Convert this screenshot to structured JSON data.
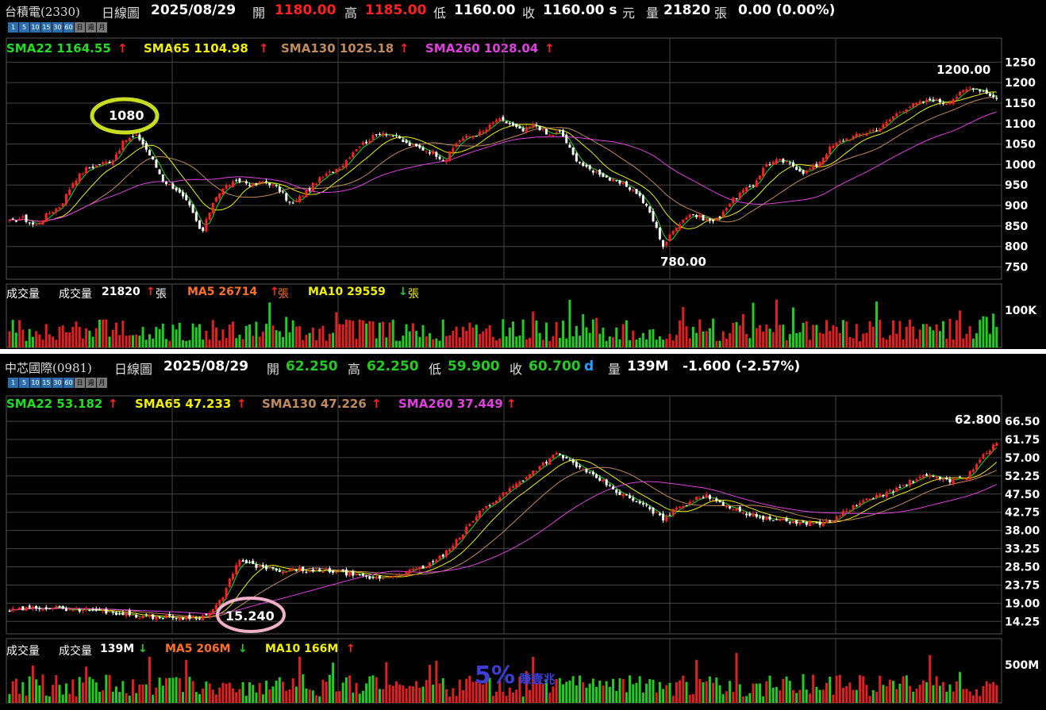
{
  "colors": {
    "up": "#ff2020",
    "down": "#ffffff",
    "vol_up": "#e02020",
    "vol_down": "#22cc22",
    "sma22": "#22dd22",
    "sma65": "#f0f000",
    "sma130": "#c08a5a",
    "sma260": "#e040e0",
    "ma5": "#ff7020",
    "ma10": "#f0f000",
    "grid": "#444444",
    "axis": "#ffffff"
  },
  "icons": {
    "arrow_up": "up-arrow-icon",
    "arrow_down": "down-arrow-icon"
  },
  "timeframes": [
    "1",
    "5",
    "10",
    "15",
    "30",
    "60",
    "日",
    "週",
    "月"
  ],
  "panels": [
    {
      "quote": {
        "name": "台積電(2330)",
        "period": "日線圖",
        "date": "2025/08/29",
        "open_label": "開",
        "open": "1180.00",
        "high_label": "高",
        "high": "1185.00",
        "low_label": "低",
        "low": "1160.00",
        "close_label": "收",
        "close": "1160.00 s",
        "unit_label": "元",
        "vol_label": "量",
        "vol": "21820",
        "vol_unit": "張",
        "change": "0.00 (0.00%)"
      },
      "sma": {
        "sma22": "SMA22 1164.55",
        "sma65": "SMA65 1104.98",
        "sma130": "SMA130 1025.18",
        "sma260": "SMA260 1028.04"
      },
      "sma_dirs": [
        "up",
        "up",
        "up",
        "up"
      ],
      "volume": {
        "title": "成交量",
        "vol_label": "成交量",
        "vol": "21820",
        "vol_unit": "張",
        "ma5": "MA5 26714",
        "ma5_unit": "張",
        "ma10": "MA10 29559",
        "ma10_unit": "張",
        "dirs": [
          "up",
          "up",
          "down"
        ]
      },
      "price_axis": [
        "1250",
        "1200",
        "1150",
        "1100",
        "1050",
        "1000",
        "950",
        "900",
        "850",
        "800",
        "750"
      ],
      "vol_axis": [
        "100K"
      ],
      "annotations": {
        "circle": "1080",
        "high": "1200.00",
        "low": "780.00"
      }
    },
    {
      "quote": {
        "name": "中芯國際(0981)",
        "period": "日線圖",
        "date": "2025/08/29",
        "open_label": "開",
        "open": "62.250",
        "high_label": "高",
        "high": "62.250",
        "low_label": "低",
        "low": "59.900",
        "close_label": "收",
        "close": "60.700",
        "close_flag": "d",
        "vol_label": "量",
        "vol": "139M",
        "change": "-1.600 (-2.57%)"
      },
      "sma": {
        "sma22": "SMA22 53.182",
        "sma65": "SMA65 47.233",
        "sma130": "SMA130 47.226",
        "sma260": "SMA260 37.449"
      },
      "sma_dirs": [
        "up",
        "up",
        "up",
        "up"
      ],
      "volume": {
        "title": "成交量",
        "vol_label": "成交量",
        "vol": "139M",
        "ma5": "MA5 206M",
        "ma10": "MA10 166M",
        "dirs": [
          "down",
          "down",
          "up"
        ]
      },
      "price_axis": [
        "66.50",
        "61.75",
        "57.00",
        "52.25",
        "47.50",
        "42.75",
        "38.00",
        "33.25",
        "28.50",
        "23.75",
        "19.00",
        "14.25"
      ],
      "vol_axis": [
        "500M"
      ],
      "annotations": {
        "circle": "15.240",
        "high": "62.800"
      }
    }
  ],
  "watermark": {
    "big": "5%",
    "small": "賺壹兆"
  },
  "chart_data": [
    {
      "type": "candlestick",
      "title": "台積電(2330) 日線圖",
      "ylim": [
        720,
        1270
      ],
      "y_ticks": [
        750,
        800,
        850,
        900,
        950,
        1000,
        1050,
        1100,
        1150,
        1200,
        1250
      ],
      "close_anchors": [
        860,
        870,
        850,
        880,
        900,
        960,
        990,
        1000,
        1010,
        1060,
        1070,
        1020,
        960,
        940,
        900,
        830,
        920,
        950,
        960,
        950,
        960,
        940,
        900,
        930,
        960,
        980,
        1000,
        1040,
        1060,
        1080,
        1070,
        1050,
        1040,
        1030,
        1010,
        1060,
        1070,
        1080,
        1110,
        1100,
        1080,
        1100,
        1070,
        1080,
        1020,
        990,
        980,
        960,
        950,
        930,
        880,
        800,
        850,
        880,
        870,
        860,
        900,
        930,
        950,
        1000,
        1010,
        1000,
        980,
        1000,
        1040,
        1060,
        1070,
        1080,
        1090,
        1120,
        1140,
        1150,
        1160,
        1150,
        1170,
        1190,
        1180,
        1160
      ],
      "high_label": 1200.0,
      "low_label": 780.0,
      "annotated_level": 1080
    },
    {
      "type": "candlestick",
      "title": "中芯國際(0981) 日線圖",
      "ylim": [
        11,
        69
      ],
      "y_ticks": [
        14.25,
        19.0,
        23.75,
        28.5,
        33.25,
        38.0,
        42.75,
        47.5,
        52.25,
        57.0,
        61.75,
        66.5
      ],
      "close_anchors": [
        17,
        17.5,
        18,
        17.8,
        17.5,
        17.2,
        17,
        16.5,
        16,
        15.5,
        15.4,
        15.3,
        15.24,
        15.8,
        20,
        30,
        29,
        28,
        27,
        28,
        27,
        27.5,
        27,
        26,
        25.5,
        26,
        27,
        28,
        30,
        33,
        38,
        43,
        46,
        49,
        52,
        55,
        58,
        56,
        53,
        51,
        48,
        46,
        44,
        41,
        44,
        46,
        47,
        45,
        43,
        42,
        41,
        40.5,
        40,
        40,
        40,
        43,
        45,
        47,
        48,
        50,
        52,
        52,
        51,
        52,
        57,
        60.7
      ],
      "high_label": 62.8,
      "annotated_level": 15.24
    }
  ]
}
